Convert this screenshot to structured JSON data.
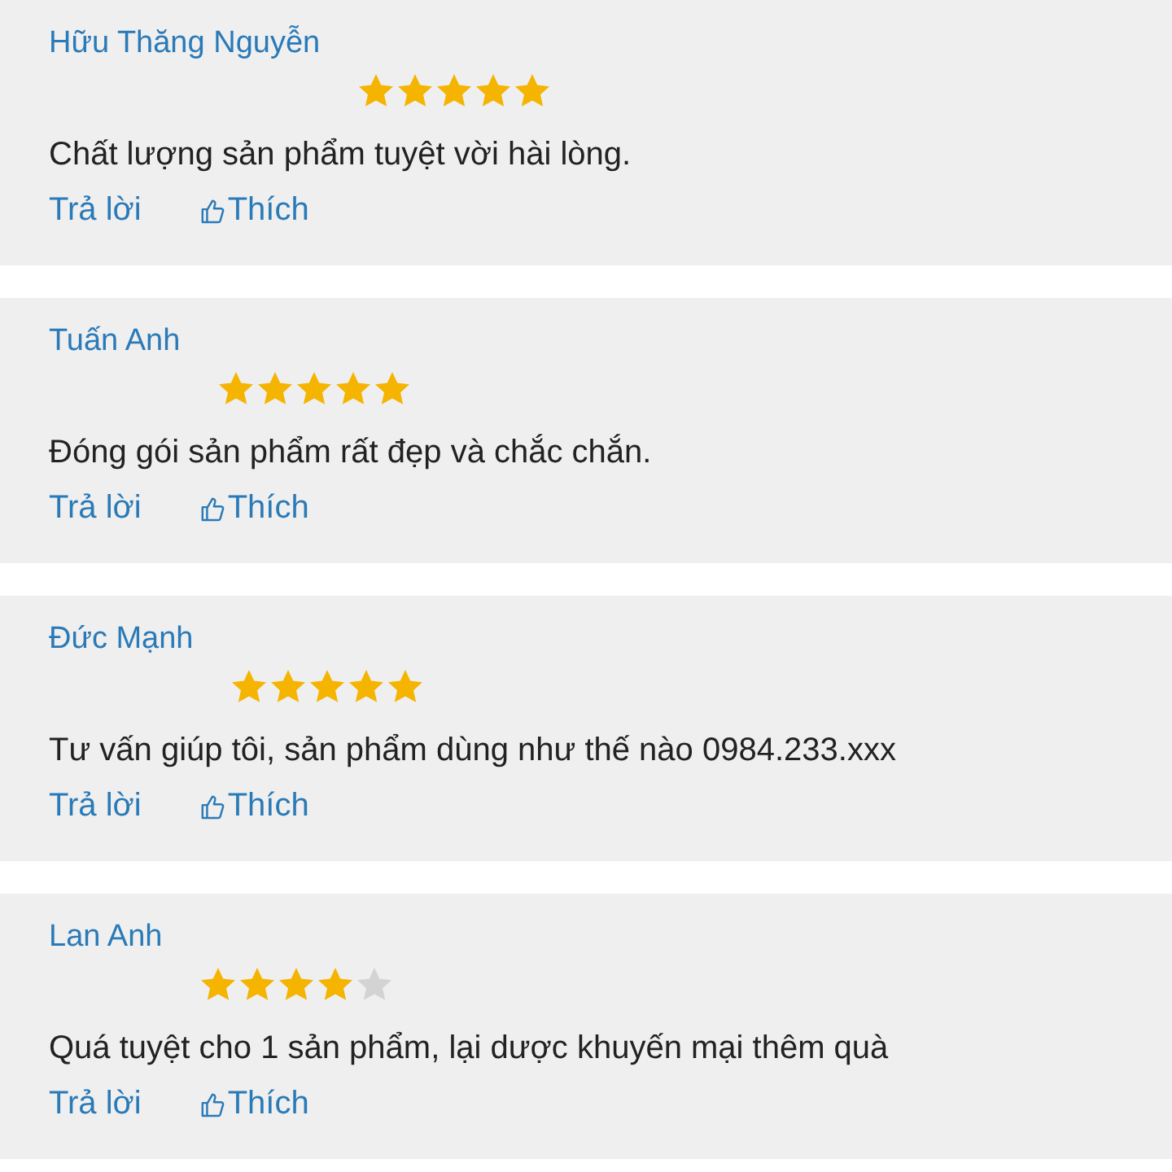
{
  "reviews": [
    {
      "name": "Hữu Thăng Nguyễn",
      "stars": 5,
      "text": "Chất lượng sản phẩm tuyệt vời hài lòng.",
      "reply": "Trả lời",
      "like": "Thích"
    },
    {
      "name": "Tuấn Anh",
      "stars": 5,
      "text": "Đóng gói sản phẩm rất đẹp và chắc chắn.",
      "reply": "Trả lời",
      "like": "Thích"
    },
    {
      "name": "Đức Mạnh",
      "stars": 5,
      "text": "Tư vấn giúp tôi, sản phẩm dùng như thế nào 0984.233.xxx",
      "reply": "Trả lời",
      "like": "Thích"
    },
    {
      "name": "Lan Anh",
      "stars": 4,
      "text": "Quá tuyệt cho 1 sản phẩm, lại dược khuyến mại thêm quà",
      "reply": "Trả lời",
      "like": "Thích"
    }
  ]
}
